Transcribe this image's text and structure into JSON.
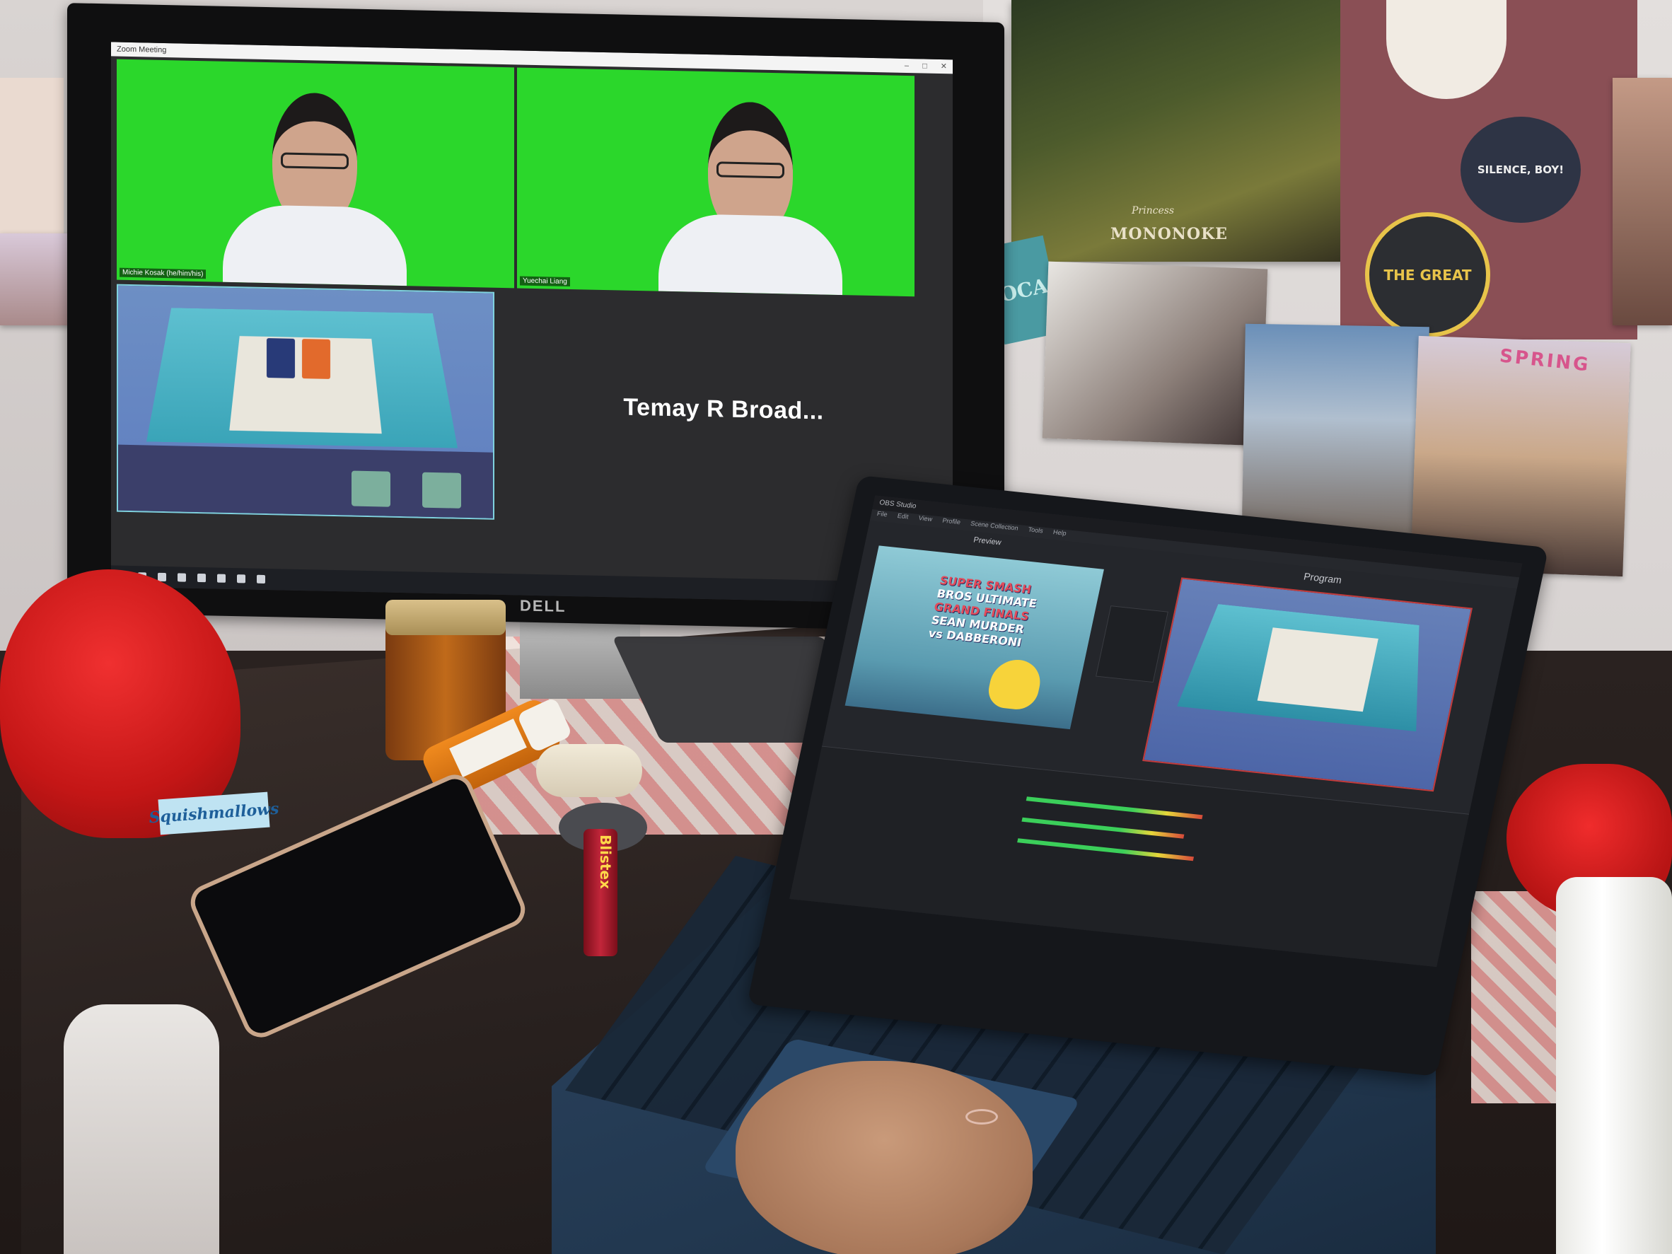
{
  "scene": {
    "description_type": "photo"
  },
  "monitor": {
    "brand": "DELL",
    "zoom_window_title": "Zoom Meeting",
    "participants": [
      {
        "name": "Michie Kosak (he/him/his)"
      },
      {
        "name": "Yuechai Liang"
      }
    ],
    "name_tile_text": "Temay R Broad..."
  },
  "laptop": {
    "obs_title": "OBS Studio",
    "obs_menu": [
      "File",
      "Edit",
      "View",
      "Profile",
      "Scene Collection",
      "Tools",
      "Help"
    ],
    "preview_label": "Preview",
    "program_label": "Program",
    "preview_lines": {
      "line1": "SUPER SMASH",
      "line2": "BROS ULTIMATE",
      "line3": "GRAND FINALS",
      "line4": "SEAN MURDER",
      "line5": "vs DABBERONI"
    }
  },
  "wall": {
    "poster_title": "MONONOKE",
    "poster_sub": "Princess",
    "sticker_great": "THE GREAT",
    "sticker_silence": "SILENCE, BOY!",
    "spring_label": "SPRING",
    "tag_card": "OCA"
  },
  "desk": {
    "chapstick_brand": "Blistex",
    "plush_tag_text": "Squishmallows"
  }
}
